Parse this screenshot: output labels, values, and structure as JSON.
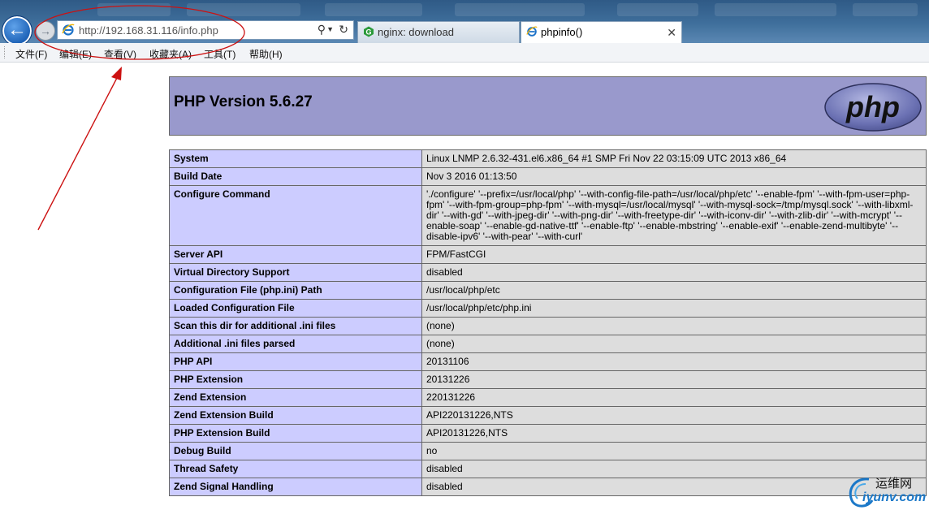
{
  "browser": {
    "address_url": "http://192.168.31.116/info.php",
    "tabs": [
      {
        "label": "nginx: download",
        "active": false
      },
      {
        "label": "phpinfo()",
        "active": true
      }
    ],
    "menu": [
      "文件(F)",
      "编辑(E)",
      "查看(V)",
      "收藏夹(A)",
      "工具(T)",
      "帮助(H)"
    ]
  },
  "page": {
    "title": "PHP Version 5.6.27",
    "logo_text": "php",
    "rows": [
      {
        "key": "System",
        "value": "Linux LNMP 2.6.32-431.el6.x86_64 #1 SMP Fri Nov 22 03:15:09 UTC 2013 x86_64"
      },
      {
        "key": "Build Date",
        "value": "Nov 3 2016 01:13:50"
      },
      {
        "key": "Configure Command",
        "value": "'./configure' '--prefix=/usr/local/php' '--with-config-file-path=/usr/local/php/etc' '--enable-fpm' '--with-fpm-user=php-fpm' '--with-fpm-group=php-fpm' '--with-mysql=/usr/local/mysql' '--with-mysql-sock=/tmp/mysql.sock' '--with-libxml-dir' '--with-gd' '--with-jpeg-dir' '--with-png-dir' '--with-freetype-dir' '--with-iconv-dir' '--with-zlib-dir' '--with-mcrypt' '--enable-soap' '--enable-gd-native-ttf' '--enable-ftp' '--enable-mbstring' '--enable-exif' '--enable-zend-multibyte' '--disable-ipv6' '--with-pear' '--with-curl'"
      },
      {
        "key": "Server API",
        "value": "FPM/FastCGI"
      },
      {
        "key": "Virtual Directory Support",
        "value": "disabled"
      },
      {
        "key": "Configuration File (php.ini) Path",
        "value": "/usr/local/php/etc"
      },
      {
        "key": "Loaded Configuration File",
        "value": "/usr/local/php/etc/php.ini"
      },
      {
        "key": "Scan this dir for additional .ini files",
        "value": "(none)"
      },
      {
        "key": "Additional .ini files parsed",
        "value": "(none)"
      },
      {
        "key": "PHP API",
        "value": "20131106"
      },
      {
        "key": "PHP Extension",
        "value": "20131226"
      },
      {
        "key": "Zend Extension",
        "value": "220131226"
      },
      {
        "key": "Zend Extension Build",
        "value": "API220131226,NTS"
      },
      {
        "key": "PHP Extension Build",
        "value": "API20131226,NTS"
      },
      {
        "key": "Debug Build",
        "value": "no"
      },
      {
        "key": "Thread Safety",
        "value": "disabled"
      },
      {
        "key": "Zend Signal Handling",
        "value": "disabled"
      }
    ]
  },
  "watermark": {
    "cn": "运维网",
    "en": "iyunv.com"
  },
  "colors": {
    "header_bg": "#9999cc",
    "key_bg": "#ccccff",
    "value_bg": "#dddddd",
    "annotation": "#cc1111"
  }
}
